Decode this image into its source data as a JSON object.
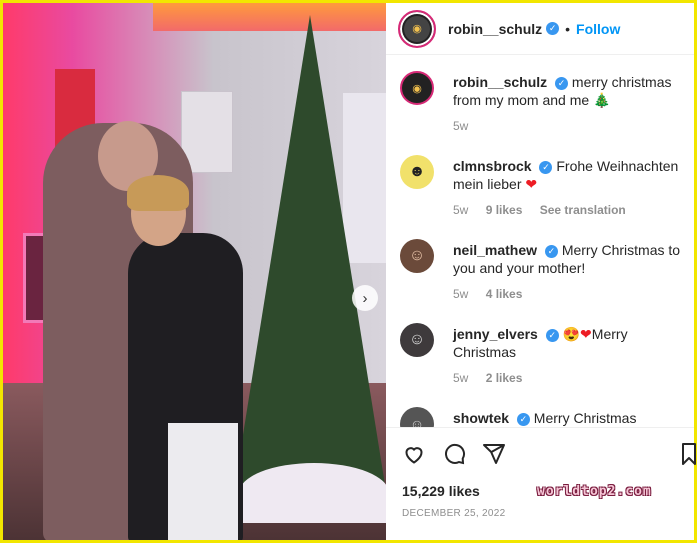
{
  "post": {
    "author": "robin__schulz",
    "follow_label": "Follow",
    "separator": "•",
    "verified_glyph": "✓"
  },
  "comments": [
    {
      "user": "robin__schulz",
      "text": "merry christmas from my mom and me ",
      "emoji": "🎄",
      "age": "5w",
      "likes": "",
      "translate": ""
    },
    {
      "user": "clmnsbrock",
      "text": "Frohe Weihnachten mein lieber ",
      "emoji": "❤",
      "age": "5w",
      "likes": "9 likes",
      "translate": "See translation"
    },
    {
      "user": "neil_mathew",
      "text": "Merry Christmas to you and your mother!",
      "emoji": "",
      "age": "5w",
      "likes": "4 likes",
      "translate": ""
    },
    {
      "user": "jenny_elvers",
      "text": "Merry Christmas",
      "emoji_prefix": "😍❤",
      "age": "5w",
      "likes": "2 likes",
      "translate": ""
    },
    {
      "user": "showtek",
      "text": "Merry Christmas",
      "emoji": ""
    }
  ],
  "footer": {
    "likes": "15,229 likes",
    "date": "DECEMBER 25, 2022"
  },
  "watermark": "worldtop2.com",
  "icons": {
    "like": "heart-outline-icon",
    "comment": "comment-bubble-icon",
    "share": "paper-plane-icon",
    "save": "bookmark-icon",
    "carousel": "chevron-right-icon"
  },
  "colors": {
    "accent": "#0095f6",
    "verified": "#3897f0",
    "border": "#f2e600"
  }
}
